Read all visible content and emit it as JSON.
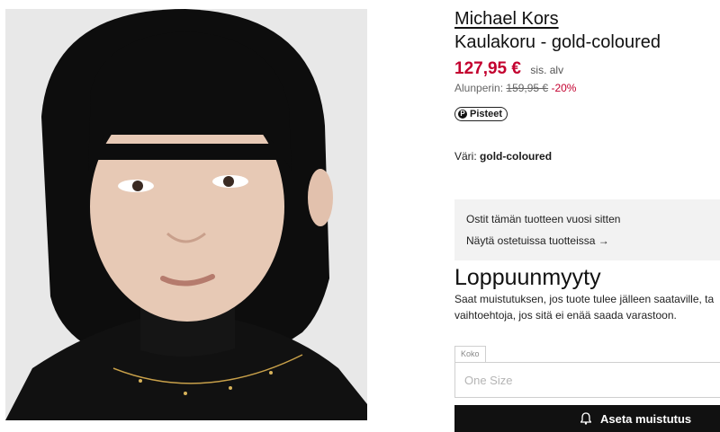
{
  "product": {
    "image_alt": "Model wearing gold-coloured necklace",
    "brand": "Michael Kors",
    "title": "Kaulakoru - gold-coloured",
    "price": "127,95 €",
    "vat_note": "sis. alv",
    "original_label": "Alunperin:",
    "original_price": "159,95 €",
    "discount": "-20%",
    "points_label": "Pisteet",
    "color_label": "Väri:",
    "color_value": "gold-coloured"
  },
  "purchase_history": {
    "text": "Ostit tämän tuotteen vuosi sitten",
    "link": "Näytä ostetuissa tuotteissa →"
  },
  "availability": {
    "title": "Loppuunmyyty",
    "description": "Saat muistutuksen, jos tuote tulee jälleen saataville, ta vaihtoehtoja, jos sitä ei enää saada varastoon."
  },
  "size": {
    "label": "Koko",
    "value": "One Size"
  },
  "reminder": {
    "button_label": "Aseta muistutus"
  },
  "colors": {
    "price_red": "#c3002f",
    "button_black": "#111111",
    "box_gray": "#f2f2f2"
  }
}
